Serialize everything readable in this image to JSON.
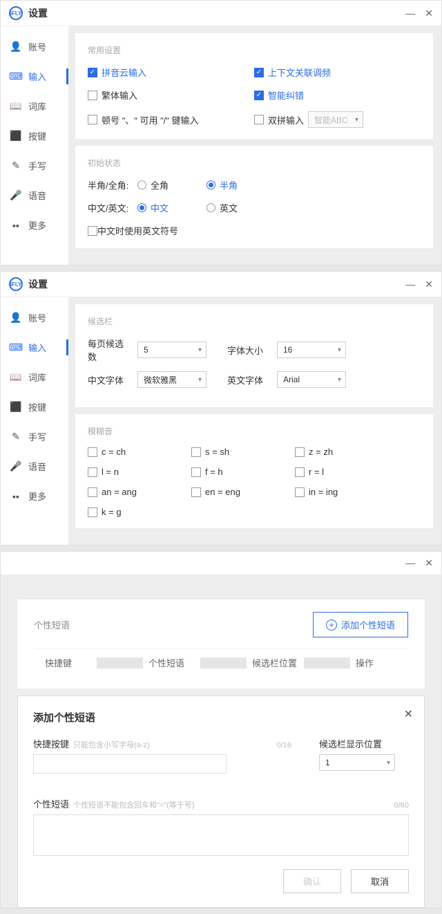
{
  "title": "设置",
  "logo": "iFLY",
  "winbtns": {
    "min": "—",
    "close": "✕"
  },
  "nav": [
    {
      "icon": "👤",
      "label": "账号"
    },
    {
      "icon": "⌨",
      "label": "输入"
    },
    {
      "icon": "📖",
      "label": "词库"
    },
    {
      "icon": "⬛",
      "label": "按键"
    },
    {
      "icon": "✎",
      "label": "手写"
    },
    {
      "icon": "🎤",
      "label": "语音"
    },
    {
      "icon": "▪▪",
      "label": "更多"
    }
  ],
  "p1": {
    "s1": {
      "title": "常用设置",
      "items": [
        {
          "label": "拼音云输入",
          "on": true
        },
        {
          "label": "上下文关联调频",
          "on": true
        },
        {
          "label": "繁体输入",
          "on": false
        },
        {
          "label": "智能纠错",
          "on": true
        },
        {
          "label": "顿号 \"、\" 可用 \"/\" 键输入",
          "on": false
        },
        {
          "label": "双拼输入",
          "on": false,
          "sel": "智能ABC"
        }
      ]
    },
    "s2": {
      "title": "初始状态",
      "g1": {
        "label": "半角/全角:",
        "a": "全角",
        "b": "半角",
        "sel": "b"
      },
      "g2": {
        "label": "中文/英文:",
        "a": "中文",
        "b": "英文",
        "sel": "a"
      },
      "cb": {
        "label": "中文时使用英文符号",
        "on": false
      }
    }
  },
  "p2": {
    "s1": {
      "title": "候选栏",
      "f1": {
        "label": "每页候选数",
        "val": "5"
      },
      "f2": {
        "label": "字体大小",
        "val": "16"
      },
      "f3": {
        "label": "中文字体",
        "val": "微软雅黑"
      },
      "f4": {
        "label": "英文字体",
        "val": "Arial"
      }
    },
    "s2": {
      "title": "模糊音",
      "items": [
        "c = ch",
        "s = sh",
        "z = zh",
        "l = n",
        "f = h",
        "r = l",
        "an = ang",
        "en = eng",
        "in = ing",
        "k = g"
      ]
    }
  },
  "p3": {
    "title": "个性短语",
    "addbtn": "添加个性短语",
    "cols": [
      "快捷键",
      "个性短语",
      "候选栏位置",
      "操作"
    ],
    "dlg": {
      "title": "添加个性短语",
      "f1": {
        "name": "快捷按键",
        "hint": "只能包含小写字母(a-z)",
        "count": "0/16"
      },
      "f2": {
        "name": "候选栏显示位置",
        "val": "1"
      },
      "f3": {
        "name": "个性短语",
        "hint": "个性短语不能包含回车和\"=\"(等于号)",
        "count": "0/60"
      },
      "ok": "确认",
      "cancel": "取消"
    }
  }
}
